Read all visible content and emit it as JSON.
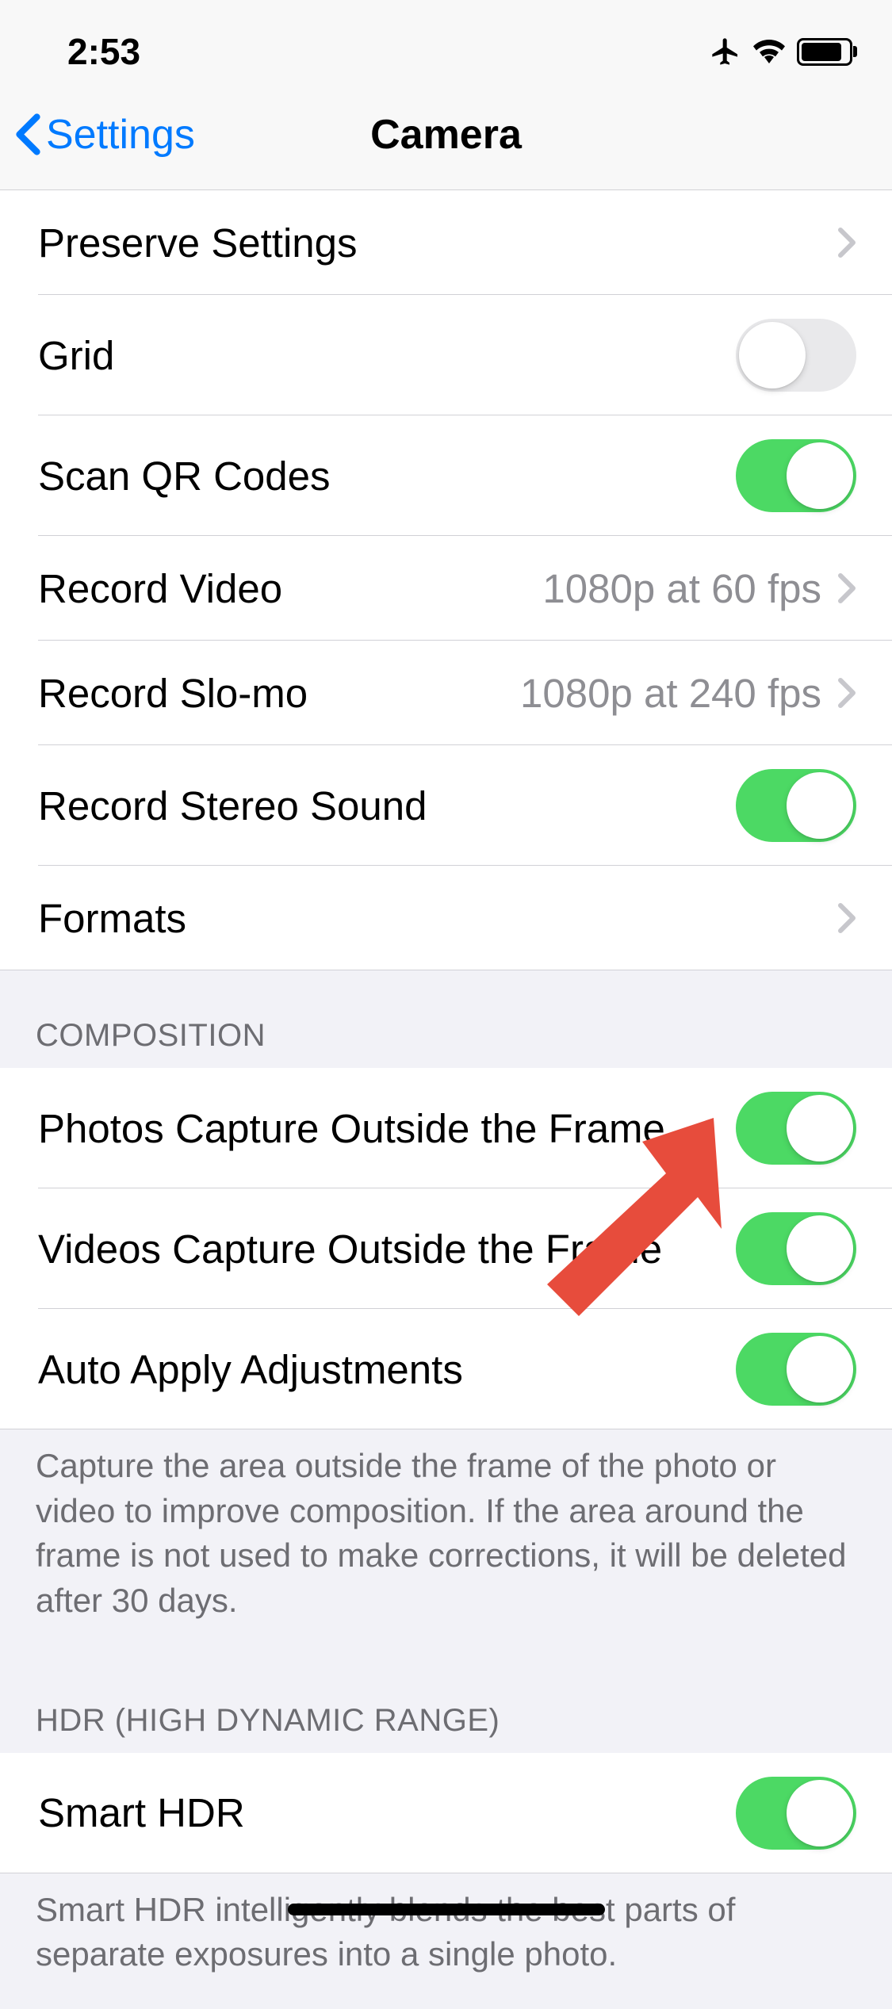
{
  "statusBar": {
    "time": "2:53"
  },
  "navBar": {
    "backLabel": "Settings",
    "title": "Camera"
  },
  "sections": {
    "main": {
      "preserveSettings": "Preserve Settings",
      "grid": "Grid",
      "scanQRCodes": "Scan QR Codes",
      "recordVideo": "Record Video",
      "recordVideoDetail": "1080p at 60 fps",
      "recordSlomo": "Record Slo-mo",
      "recordSlomoDetail": "1080p at 240 fps",
      "recordStereoSound": "Record Stereo Sound",
      "formats": "Formats"
    },
    "composition": {
      "header": "COMPOSITION",
      "photosOutside": "Photos Capture Outside the Frame",
      "videosOutside": "Videos Capture Outside the Frame",
      "autoApply": "Auto Apply Adjustments",
      "footer": "Capture the area outside the frame of the photo or video to improve composition. If the area around the frame is not used to make corrections, it will be deleted after 30 days."
    },
    "hdr": {
      "header": "HDR (HIGH DYNAMIC RANGE)",
      "smartHDR": "Smart HDR",
      "footer": "Smart HDR intelligently blends the best parts of separate exposures into a single photo."
    }
  },
  "toggles": {
    "grid": false,
    "scanQRCodes": true,
    "recordStereoSound": true,
    "photosOutside": true,
    "videosOutside": true,
    "autoApply": true,
    "smartHDR": true
  }
}
